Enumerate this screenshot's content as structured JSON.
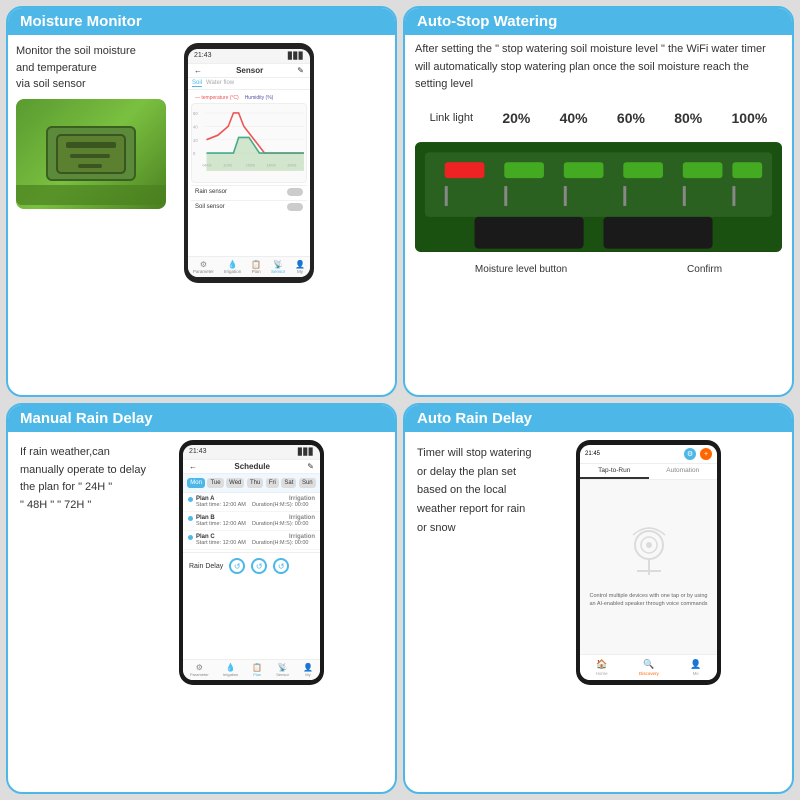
{
  "cards": {
    "moisture_monitor": {
      "title": "Moisture Monitor",
      "desc_line1": "Monitor the soil moisture",
      "desc_line2": "and temperature",
      "desc_line3": "via soil sensor",
      "phone": {
        "time": "21:43",
        "title": "Sensor",
        "tabs": [
          "Soil",
          "Water flow"
        ],
        "legend_temp": "— temperature (°C)",
        "legend_hum": "Humidity (%)",
        "nav": [
          "Parameter",
          "Irrigation control",
          "Plan",
          "Sensor",
          "My"
        ],
        "rain_sensor": "Rain sensor",
        "soil_sensor": "Soil sensor"
      }
    },
    "auto_stop": {
      "title": "Auto-Stop Watering",
      "desc": "After setting the \" stop watering soil moisture level \" the WiFi water timer will automatically stop watering plan once the soil moisture reach the setting level",
      "link_light": "Link light",
      "levels": [
        "20%",
        "40%",
        "60%",
        "80%",
        "100%"
      ],
      "moisture_level_button": "Moisture level button",
      "confirm": "Confirm"
    },
    "manual_rain": {
      "title": "Manual Rain Delay",
      "desc_line1": "If rain weather,can",
      "desc_line2": "manually operate to delay",
      "desc_line3": "the plan for \" 24H \"",
      "desc_line4": "\" 48H \" \" 72H \"",
      "phone": {
        "time": "21:43",
        "title": "Schedule",
        "days": [
          "Mon",
          "Tue",
          "Wed",
          "Thu",
          "Fri",
          "Sat",
          "Sun"
        ],
        "active_day": "Mon",
        "plans": [
          {
            "name": "Plan A",
            "type": "Irrigation",
            "start": "Start time: 12:00 AM",
            "duration": "Duration(H:M:S): 00:00"
          },
          {
            "name": "Plan B",
            "type": "Irrigation",
            "start": "Start time: 12:00 AM",
            "duration": "Duration(H:M:S): 00:00"
          },
          {
            "name": "Plan C",
            "type": "Irrigation",
            "start": "Start time: 12:00 AM",
            "duration": "Duration(H:M:S): 00:00"
          }
        ],
        "rain_delay": "Rain Delay",
        "nav": [
          "Parameter",
          "Irrigation control",
          "Plan",
          "Sensor",
          "My"
        ]
      }
    },
    "auto_rain": {
      "title": "Auto Rain Delay",
      "desc_line1": "Timer will stop watering",
      "desc_line2": "or delay the plan set",
      "desc_line3": "based on the local",
      "desc_line4": "weather report for rain",
      "desc_line5": "or snow",
      "phone": {
        "time": "21:45",
        "tab1": "Tap-to-Run",
        "tab2": "Automation",
        "caption": "Control multiple devices with one tap or by using an AI-enabled speaker through voice commands",
        "nav": [
          "Home",
          "Discovery",
          "Me"
        ]
      }
    }
  }
}
